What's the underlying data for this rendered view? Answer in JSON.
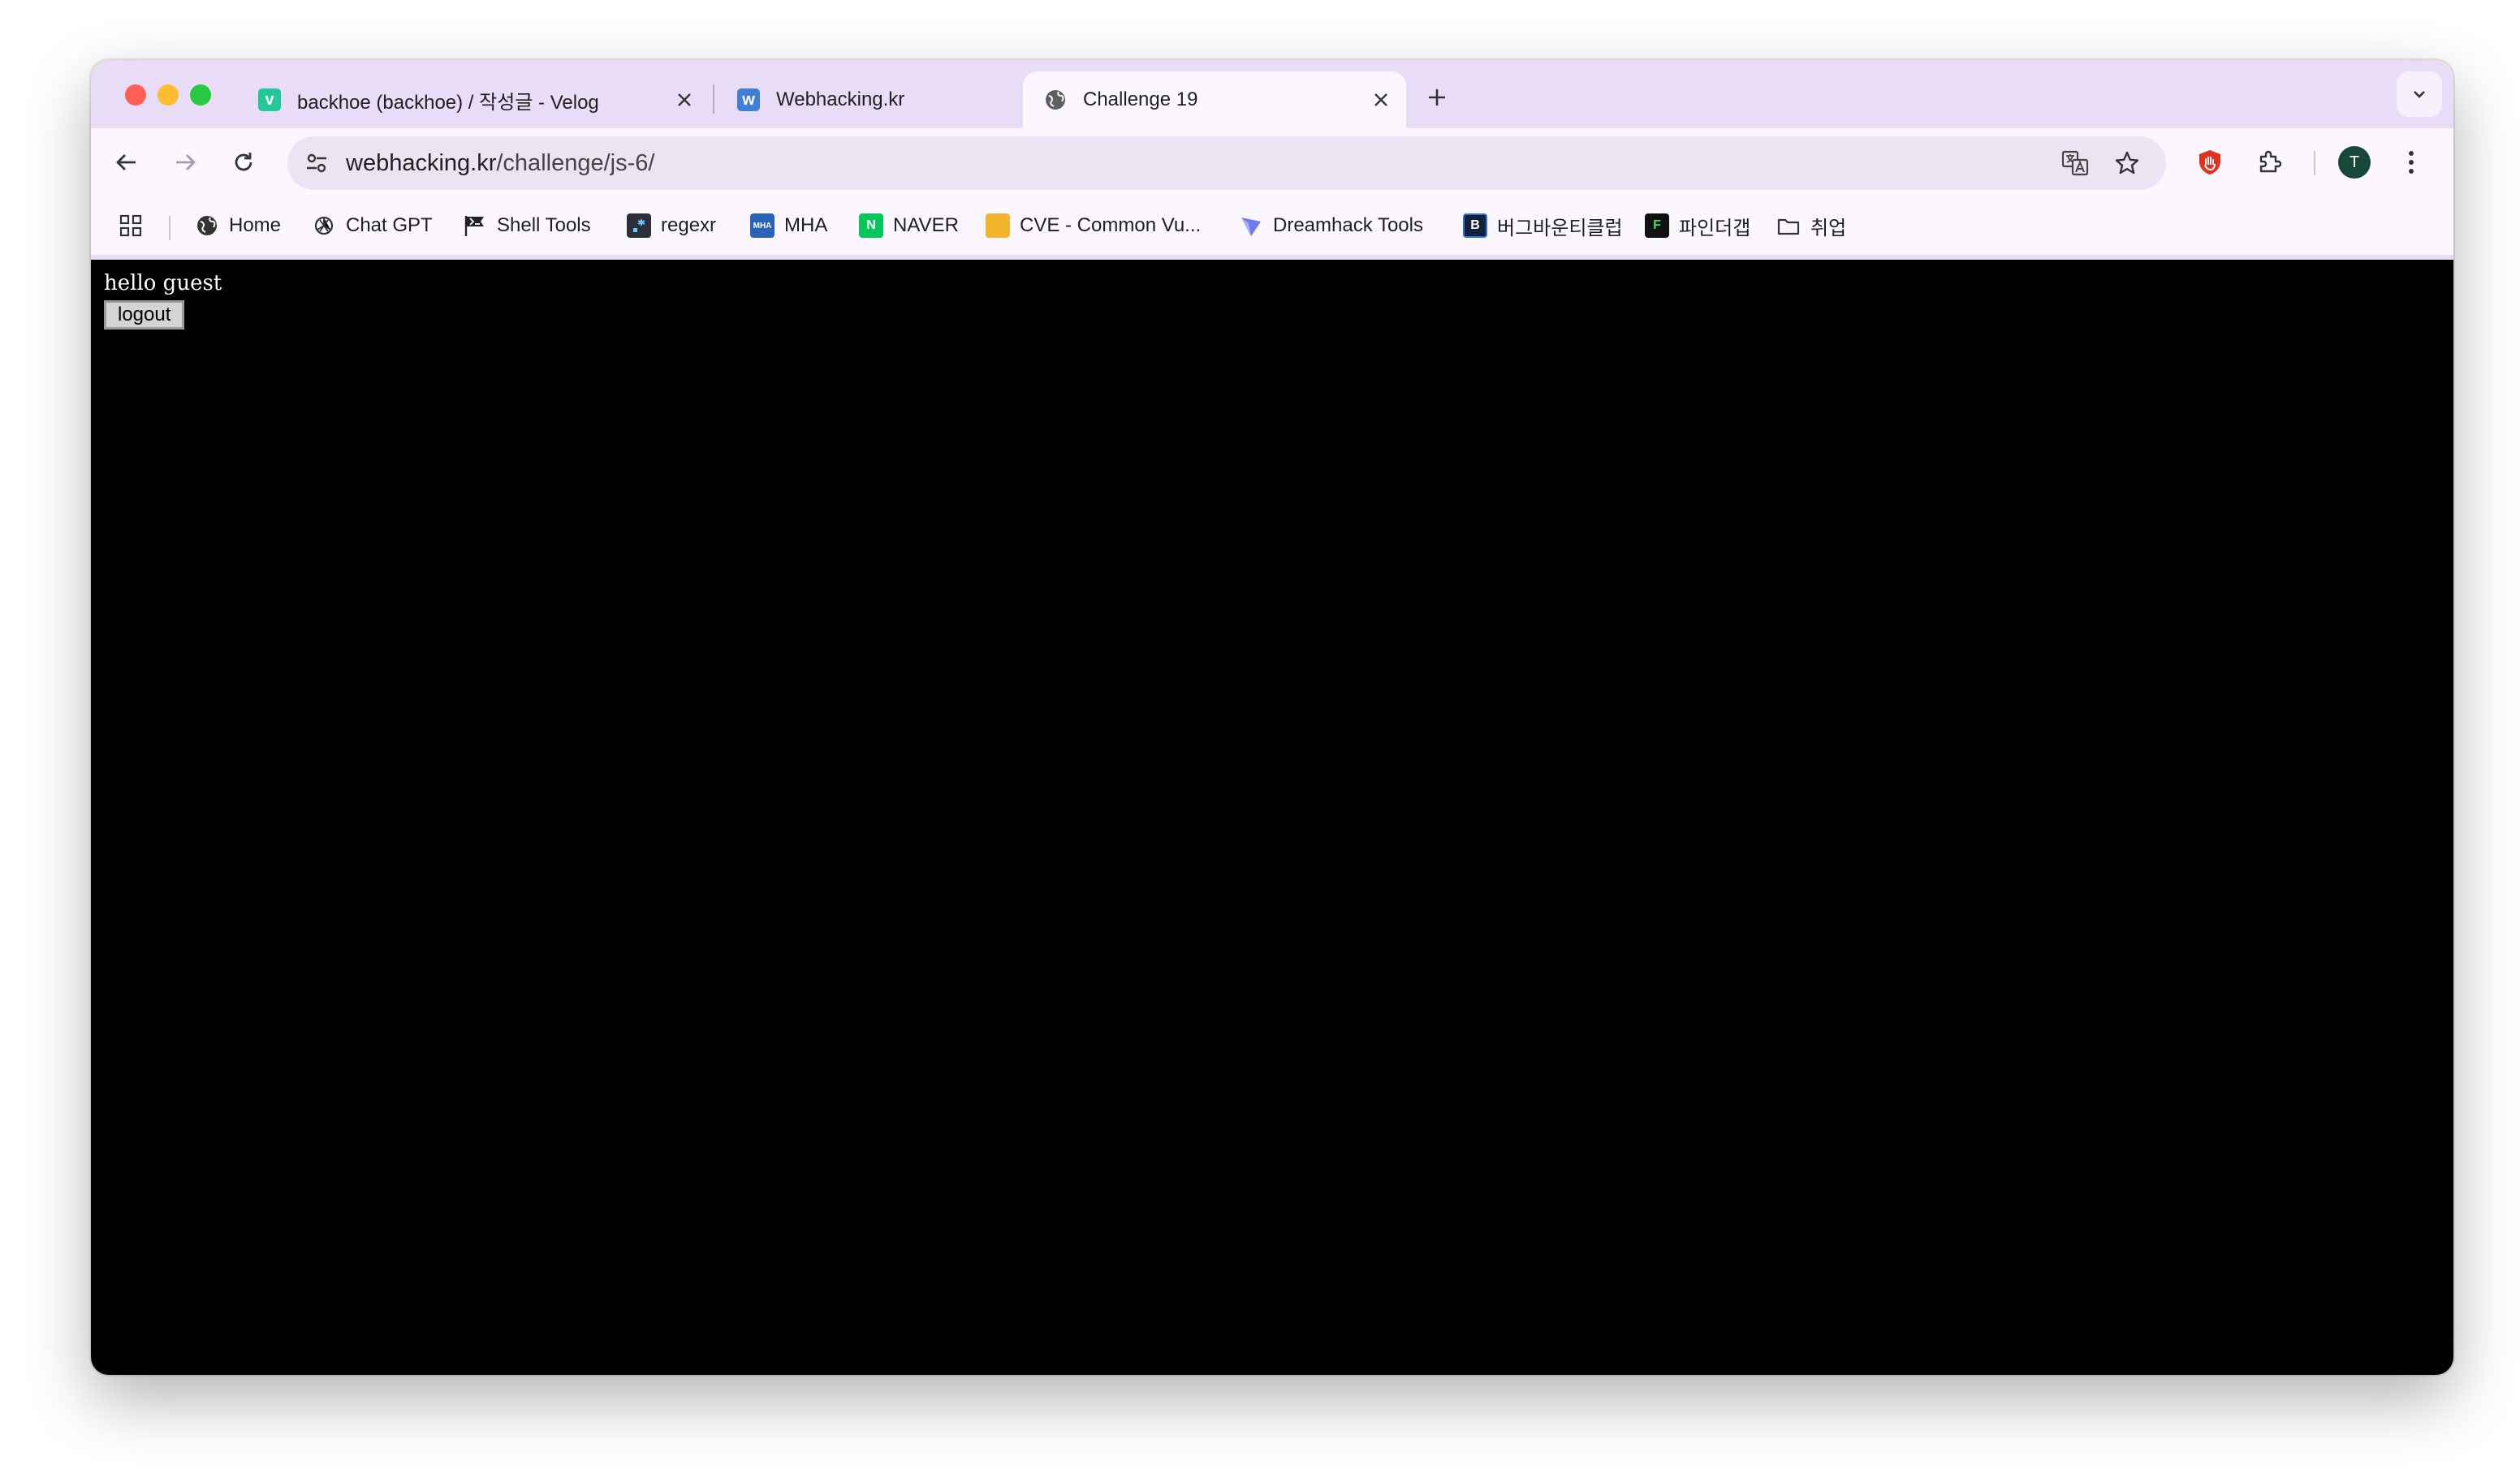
{
  "tabs": [
    {
      "title": "backhoe (backhoe) / 작성글 - Velog",
      "favicon_letter": "v",
      "favicon_color": "#20c997",
      "active": false
    },
    {
      "title": "Webhacking.kr",
      "favicon_letter": "w",
      "favicon_color": "#3f7fd6",
      "active": false
    },
    {
      "title": "Challenge 19",
      "favicon_letter": "",
      "favicon_color": "#5f5f5f",
      "active": true
    }
  ],
  "address_bar": {
    "host": "webhacking.kr",
    "path": "/challenge/js-6/"
  },
  "profile_initial": "T",
  "bookmarks": [
    {
      "label": "Home",
      "icon": "globe-icon"
    },
    {
      "label": "Chat GPT",
      "icon": "openai-icon"
    },
    {
      "label": "Shell Tools",
      "icon": "flag-icon"
    },
    {
      "label": "regexr",
      "icon": "regexr-icon"
    },
    {
      "label": "MHA",
      "icon": "mha-icon",
      "badge": "MHA"
    },
    {
      "label": "NAVER",
      "icon": "naver-icon",
      "badge": "N"
    },
    {
      "label": "CVE - Common Vu...",
      "icon": "cve-icon"
    },
    {
      "label": "Dreamhack Tools",
      "icon": "dreamhack-icon"
    },
    {
      "label": "버그바운티클럽",
      "icon": "bugbounty-icon",
      "badge": "B"
    },
    {
      "label": "파인더갭",
      "icon": "findthegap-icon",
      "badge": "F"
    },
    {
      "label": "취업",
      "icon": "folder-icon"
    }
  ],
  "page": {
    "greeting": "hello guest",
    "logout_label": "logout"
  },
  "colors": {
    "tabstrip_bg": "#e8dcf6",
    "toolbar_bg": "#fcf7ff",
    "page_bg": "#000000",
    "page_text": "#ffffff"
  }
}
